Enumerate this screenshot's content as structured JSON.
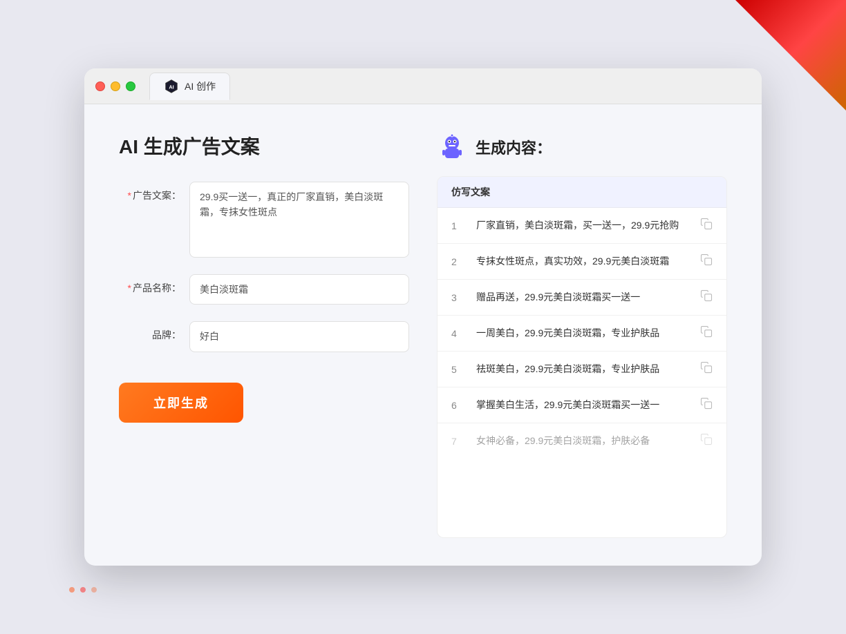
{
  "browser": {
    "tab_title": "AI 创作",
    "traffic_lights": [
      "red",
      "yellow",
      "green"
    ]
  },
  "left_panel": {
    "page_title": "AI 生成广告文案",
    "form": {
      "ad_copy_label": "广告文案：",
      "ad_copy_required": "＊",
      "ad_copy_value": "29.9买一送一，真正的厂家直销，美白淡斑霜，专抹女性斑点",
      "product_name_label": "产品名称：",
      "product_name_required": "＊",
      "product_name_value": "美白淡斑霜",
      "brand_label": "品牌：",
      "brand_value": "好白"
    },
    "generate_button": "立即生成"
  },
  "right_panel": {
    "title": "生成内容：",
    "table_header": "仿写文案",
    "results": [
      {
        "num": "1",
        "text": "厂家直销，美白淡斑霜，买一送一，29.9元抢购",
        "dimmed": false
      },
      {
        "num": "2",
        "text": "专抹女性斑点，真实功效，29.9元美白淡斑霜",
        "dimmed": false
      },
      {
        "num": "3",
        "text": "赠品再送，29.9元美白淡斑霜买一送一",
        "dimmed": false
      },
      {
        "num": "4",
        "text": "一周美白，29.9元美白淡斑霜，专业护肤品",
        "dimmed": false
      },
      {
        "num": "5",
        "text": "祛斑美白，29.9元美白淡斑霜，专业护肤品",
        "dimmed": false
      },
      {
        "num": "6",
        "text": "掌握美白生活，29.9元美白淡斑霜买一送一",
        "dimmed": false
      },
      {
        "num": "7",
        "text": "女神必备，29.9元美白淡斑霜，护肤必备",
        "dimmed": true
      }
    ]
  }
}
